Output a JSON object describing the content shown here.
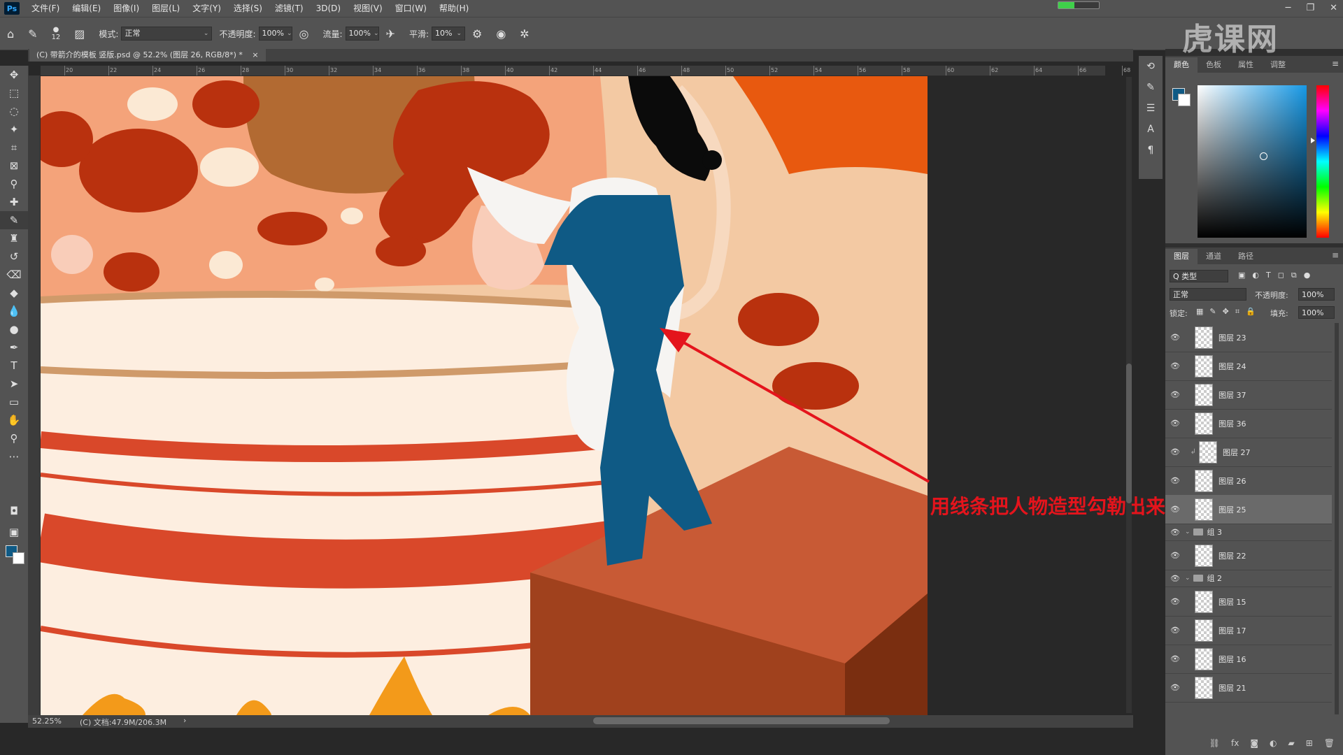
{
  "menubar": {
    "logo": "Ps",
    "items": [
      "文件(F)",
      "编辑(E)",
      "图像(I)",
      "图层(L)",
      "文字(Y)",
      "选择(S)",
      "滤镜(T)",
      "3D(D)",
      "视图(V)",
      "窗口(W)",
      "帮助(H)"
    ],
    "progress_fraction": 0.4
  },
  "options": {
    "brush_size": "12",
    "mode_label": "模式:",
    "mode_value": "正常",
    "opacity_label": "不透明度:",
    "opacity_value": "100%",
    "flow_label": "流量:",
    "flow_value": "100%",
    "smoothing_label": "平滑:",
    "smoothing_value": "10%"
  },
  "document": {
    "tab_title": "(C) 带箭介的模板 竖版.psd @ 52.2% (图层 26, RGB/8*) *",
    "zoom": "52.25%",
    "doc_info": "(C) 文档:47.9M/206.3M",
    "ruler_ticks": [
      "20",
      "22",
      "24",
      "26",
      "28",
      "30",
      "32",
      "34",
      "36",
      "38",
      "40",
      "42",
      "44",
      "46",
      "48",
      "50",
      "52",
      "54",
      "56",
      "58",
      "60",
      "62",
      "64",
      "66",
      "68"
    ]
  },
  "annotation": "用线条把人物造型勾勒出来",
  "color_panel": {
    "tabs": [
      "颜色",
      "色板",
      "属性",
      "调整"
    ],
    "fg_color": "#0f5a85",
    "bg_color": "#ffffff"
  },
  "layers_panel": {
    "tabs": [
      "图层",
      "通道",
      "路径"
    ],
    "filter_label": "Q 类型",
    "blend_mode": "正常",
    "opacity_label": "不透明度:",
    "opacity_value": "100%",
    "lock_label": "锁定:",
    "fill_label": "填充:",
    "fill_value": "100%",
    "rows": [
      {
        "name": "图层 23"
      },
      {
        "name": "图层 24"
      },
      {
        "name": "图层 37"
      },
      {
        "name": "图层 36"
      },
      {
        "name": "图层 27"
      },
      {
        "name": "图层 26"
      },
      {
        "name": "图层 25"
      },
      {
        "name": "组 3"
      },
      {
        "name": "图层 22"
      },
      {
        "name": "组 2"
      },
      {
        "name": "图层 15"
      },
      {
        "name": "图层 17"
      },
      {
        "name": "图层 16"
      },
      {
        "name": "图层 21"
      }
    ]
  },
  "watermark": "虎课网"
}
